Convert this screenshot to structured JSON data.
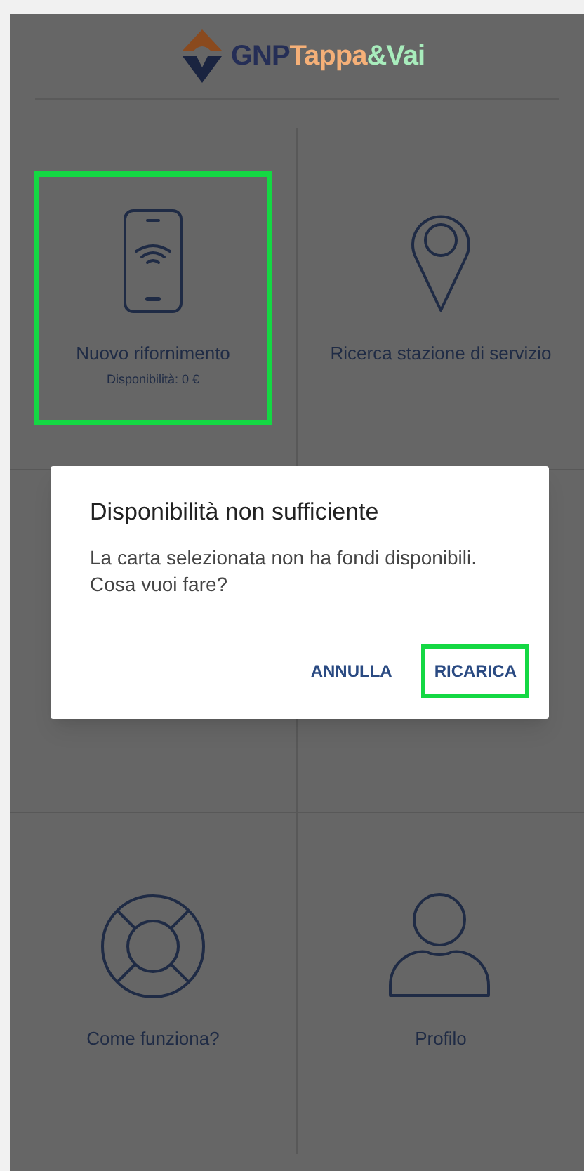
{
  "logo": {
    "brand": "GNP",
    "name_part_1": "Tappa",
    "name_part_2": "&Vai"
  },
  "tiles": [
    {
      "kind": "phone",
      "label": "Nuovo rifornimento",
      "subtitle": "Disponibilità: 0 €",
      "highlighted": true
    },
    {
      "kind": "pin",
      "label": "Ricerca stazione di servizio",
      "highlighted": false
    },
    {
      "kind": "hidden"
    },
    {
      "kind": "hidden"
    },
    {
      "kind": "lifebuoy",
      "label": "Come funziona?",
      "highlighted": false
    },
    {
      "kind": "person",
      "label": "Profilo",
      "highlighted": false
    }
  ],
  "dialog": {
    "title": "Disponibilità non sufficiente",
    "message": "La carta selezionata non ha fondi disponibili. Cosa vuoi fare?",
    "buttons": [
      {
        "label": "ANNULLA",
        "highlighted": false
      },
      {
        "label": "RICARICA",
        "highlighted": true
      }
    ]
  }
}
